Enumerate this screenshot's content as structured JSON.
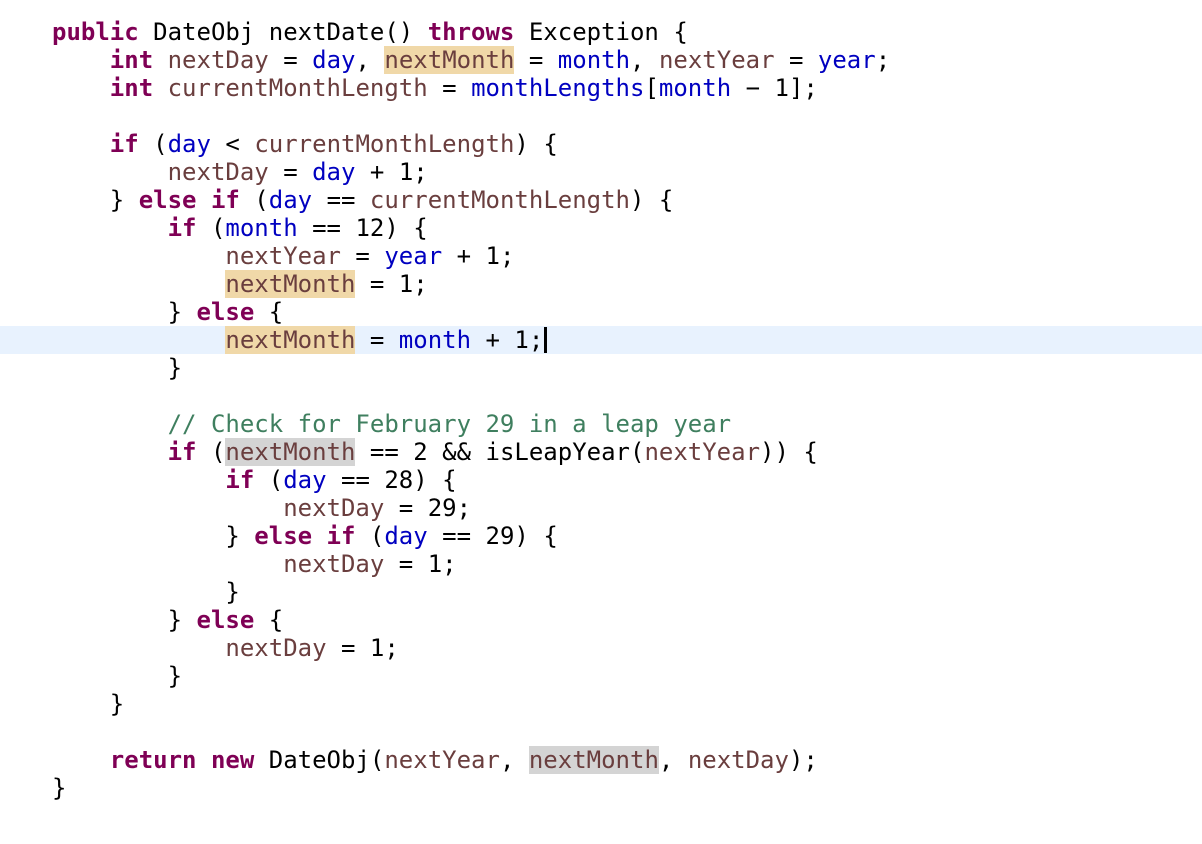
{
  "editor": {
    "language": "java",
    "current_line_index": 11,
    "colors": {
      "keyword": "#7f0055",
      "field": "#0000c0",
      "local_variable": "#6a3e3e",
      "comment": "#3f7f5f",
      "current_line_bg": "#e8f2fe",
      "write_occurrence_bg": "#f0d8a8",
      "read_occurrence_bg": "#d4d4d4"
    },
    "lines": [
      {
        "indent": 0,
        "tokens": [
          {
            "t": "public",
            "k": "kw"
          },
          {
            "t": " DateObj nextDate() ",
            "k": "plain"
          },
          {
            "t": "throws",
            "k": "kw"
          },
          {
            "t": " Exception {",
            "k": "plain"
          }
        ]
      },
      {
        "indent": 1,
        "tokens": [
          {
            "t": "int",
            "k": "kw"
          },
          {
            "t": " ",
            "k": "plain"
          },
          {
            "t": "nextDay",
            "k": "local"
          },
          {
            "t": " = ",
            "k": "plain"
          },
          {
            "t": "day",
            "k": "field"
          },
          {
            "t": ", ",
            "k": "plain"
          },
          {
            "t": "nextMonth",
            "k": "local",
            "hl": "write"
          },
          {
            "t": " = ",
            "k": "plain"
          },
          {
            "t": "month",
            "k": "field"
          },
          {
            "t": ", ",
            "k": "plain"
          },
          {
            "t": "nextYear",
            "k": "local"
          },
          {
            "t": " = ",
            "k": "plain"
          },
          {
            "t": "year",
            "k": "field"
          },
          {
            "t": ";",
            "k": "plain"
          }
        ]
      },
      {
        "indent": 1,
        "tokens": [
          {
            "t": "int",
            "k": "kw"
          },
          {
            "t": " ",
            "k": "plain"
          },
          {
            "t": "currentMonthLength",
            "k": "local"
          },
          {
            "t": " = ",
            "k": "plain"
          },
          {
            "t": "monthLengths",
            "k": "field"
          },
          {
            "t": "[",
            "k": "plain"
          },
          {
            "t": "month",
            "k": "field"
          },
          {
            "t": " − 1];",
            "k": "plain"
          }
        ]
      },
      {
        "indent": 0,
        "tokens": []
      },
      {
        "indent": 1,
        "tokens": [
          {
            "t": "if",
            "k": "kw"
          },
          {
            "t": " (",
            "k": "plain"
          },
          {
            "t": "day",
            "k": "field"
          },
          {
            "t": " < ",
            "k": "plain"
          },
          {
            "t": "currentMonthLength",
            "k": "local"
          },
          {
            "t": ") {",
            "k": "plain"
          }
        ]
      },
      {
        "indent": 2,
        "tokens": [
          {
            "t": "nextDay",
            "k": "local"
          },
          {
            "t": " = ",
            "k": "plain"
          },
          {
            "t": "day",
            "k": "field"
          },
          {
            "t": " + 1;",
            "k": "plain"
          }
        ]
      },
      {
        "indent": 1,
        "tokens": [
          {
            "t": "} ",
            "k": "plain"
          },
          {
            "t": "else",
            "k": "kw"
          },
          {
            "t": " ",
            "k": "plain"
          },
          {
            "t": "if",
            "k": "kw"
          },
          {
            "t": " (",
            "k": "plain"
          },
          {
            "t": "day",
            "k": "field"
          },
          {
            "t": " == ",
            "k": "plain"
          },
          {
            "t": "currentMonthLength",
            "k": "local"
          },
          {
            "t": ") {",
            "k": "plain"
          }
        ]
      },
      {
        "indent": 2,
        "tokens": [
          {
            "t": "if",
            "k": "kw"
          },
          {
            "t": " (",
            "k": "plain"
          },
          {
            "t": "month",
            "k": "field"
          },
          {
            "t": " == 12) {",
            "k": "plain"
          }
        ]
      },
      {
        "indent": 3,
        "tokens": [
          {
            "t": "nextYear",
            "k": "local"
          },
          {
            "t": " = ",
            "k": "plain"
          },
          {
            "t": "year",
            "k": "field"
          },
          {
            "t": " + 1;",
            "k": "plain"
          }
        ]
      },
      {
        "indent": 3,
        "tokens": [
          {
            "t": "nextMonth",
            "k": "local",
            "hl": "write"
          },
          {
            "t": " = 1;",
            "k": "plain"
          }
        ]
      },
      {
        "indent": 2,
        "tokens": [
          {
            "t": "} ",
            "k": "plain"
          },
          {
            "t": "else",
            "k": "kw"
          },
          {
            "t": " {",
            "k": "plain"
          }
        ]
      },
      {
        "indent": 3,
        "tokens": [
          {
            "t": "nextMonth",
            "k": "local",
            "hl": "write"
          },
          {
            "t": " = ",
            "k": "plain"
          },
          {
            "t": "month",
            "k": "field"
          },
          {
            "t": " + 1;",
            "k": "plain"
          }
        ],
        "caret": true
      },
      {
        "indent": 2,
        "tokens": [
          {
            "t": "}",
            "k": "plain"
          }
        ]
      },
      {
        "indent": 0,
        "tokens": []
      },
      {
        "indent": 2,
        "tokens": [
          {
            "t": "// Check for February 29 in a leap year",
            "k": "comment"
          }
        ]
      },
      {
        "indent": 2,
        "tokens": [
          {
            "t": "if",
            "k": "kw"
          },
          {
            "t": " (",
            "k": "plain"
          },
          {
            "t": "nextMonth",
            "k": "local",
            "hl": "read"
          },
          {
            "t": " == 2 && isLeapYear(",
            "k": "plain"
          },
          {
            "t": "nextYear",
            "k": "local"
          },
          {
            "t": ")) {",
            "k": "plain"
          }
        ]
      },
      {
        "indent": 3,
        "tokens": [
          {
            "t": "if",
            "k": "kw"
          },
          {
            "t": " (",
            "k": "plain"
          },
          {
            "t": "day",
            "k": "field"
          },
          {
            "t": " == 28) {",
            "k": "plain"
          }
        ]
      },
      {
        "indent": 4,
        "tokens": [
          {
            "t": "nextDay",
            "k": "local"
          },
          {
            "t": " = 29;",
            "k": "plain"
          }
        ]
      },
      {
        "indent": 3,
        "tokens": [
          {
            "t": "} ",
            "k": "plain"
          },
          {
            "t": "else",
            "k": "kw"
          },
          {
            "t": " ",
            "k": "plain"
          },
          {
            "t": "if",
            "k": "kw"
          },
          {
            "t": " (",
            "k": "plain"
          },
          {
            "t": "day",
            "k": "field"
          },
          {
            "t": " == 29) {",
            "k": "plain"
          }
        ]
      },
      {
        "indent": 4,
        "tokens": [
          {
            "t": "nextDay",
            "k": "local"
          },
          {
            "t": " = 1;",
            "k": "plain"
          }
        ]
      },
      {
        "indent": 3,
        "tokens": [
          {
            "t": "}",
            "k": "plain"
          }
        ]
      },
      {
        "indent": 2,
        "tokens": [
          {
            "t": "} ",
            "k": "plain"
          },
          {
            "t": "else",
            "k": "kw"
          },
          {
            "t": " {",
            "k": "plain"
          }
        ]
      },
      {
        "indent": 3,
        "tokens": [
          {
            "t": "nextDay",
            "k": "local"
          },
          {
            "t": " = 1;",
            "k": "plain"
          }
        ]
      },
      {
        "indent": 2,
        "tokens": [
          {
            "t": "}",
            "k": "plain"
          }
        ]
      },
      {
        "indent": 1,
        "tokens": [
          {
            "t": "}",
            "k": "plain"
          }
        ]
      },
      {
        "indent": 0,
        "tokens": []
      },
      {
        "indent": 1,
        "tokens": [
          {
            "t": "return",
            "k": "kw"
          },
          {
            "t": " ",
            "k": "plain"
          },
          {
            "t": "new",
            "k": "kw"
          },
          {
            "t": " DateObj(",
            "k": "plain"
          },
          {
            "t": "nextYear",
            "k": "local"
          },
          {
            "t": ", ",
            "k": "plain"
          },
          {
            "t": "nextMonth",
            "k": "local",
            "hl": "read"
          },
          {
            "t": ", ",
            "k": "plain"
          },
          {
            "t": "nextDay",
            "k": "local"
          },
          {
            "t": ");",
            "k": "plain"
          }
        ]
      },
      {
        "indent": 0,
        "tokens": [
          {
            "t": "}",
            "k": "plain"
          }
        ]
      }
    ]
  }
}
